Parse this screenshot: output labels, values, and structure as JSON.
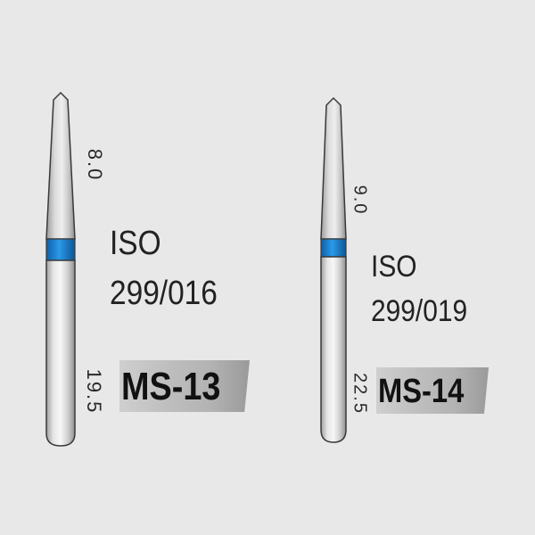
{
  "products": [
    {
      "head_length": "8.0",
      "total_length": "19.5",
      "iso_label": "ISO",
      "iso_code": "299/016",
      "model": "MS-13",
      "color_band": "#1a7fd0"
    },
    {
      "head_length": "9.0",
      "total_length": "22.5",
      "iso_label": "ISO",
      "iso_code": "299/019",
      "model": "MS-14",
      "color_band": "#1a7fd0"
    }
  ],
  "colors": {
    "background": "#e8e8e8",
    "outline": "#3a3a3a",
    "metal_light": "#f4f4f4",
    "metal_dark": "#9c9c9c"
  }
}
